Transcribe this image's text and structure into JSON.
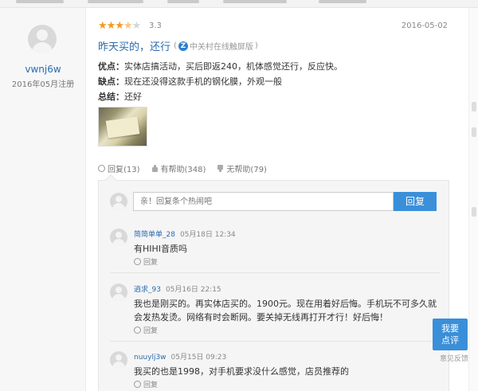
{
  "review": {
    "user": {
      "name": "vwnj6w",
      "register_date": "2016年05月注册"
    },
    "rating": {
      "value": 3.3,
      "score_text": "3.3",
      "stars_full": 3,
      "stars_half": 1,
      "stars_empty": 1
    },
    "date": "2016-05-02",
    "title": "昨天买的，还行",
    "source": {
      "icon": "zol-logo-icon",
      "label": "中关村在线触屏版"
    },
    "pros_label": "优点：",
    "pros": "实体店搞活动，买后即返240，机体感觉还行，反应快。",
    "cons_label": "缺点：",
    "cons": "现在还没得这款手机的钢化膜，外观一般",
    "summary_label": "总结：",
    "summary": "还好",
    "actions": {
      "reply": "回复(13)",
      "helpful": "有帮助(348)",
      "unhelpful": "无帮助(79)"
    }
  },
  "reply_box": {
    "placeholder": "亲！回复条个热闹吧",
    "button": "回复"
  },
  "comments": [
    {
      "name": "简简单单_28",
      "time": "05月18日 12:34",
      "text": "有HIHI音质吗",
      "reply": "回复"
    },
    {
      "name": "逍求_93",
      "time": "05月16日 22:15",
      "text": "我也是刚买的。再实体店买的。1900元。现在用着好后悔。手机玩不可多久就会发热发烫。网络有时会断网。要关掉无线再打开才行！好后悔！",
      "reply": "回复"
    },
    {
      "name": "nuuylj3w",
      "time": "05月15日 09:23",
      "text": "我买的也是1998，对手机要求没什么感觉，店员推荐的",
      "reply": "回复"
    }
  ],
  "float_button": {
    "line1": "我要",
    "line2": "点评"
  },
  "feedback": "意见反馈"
}
